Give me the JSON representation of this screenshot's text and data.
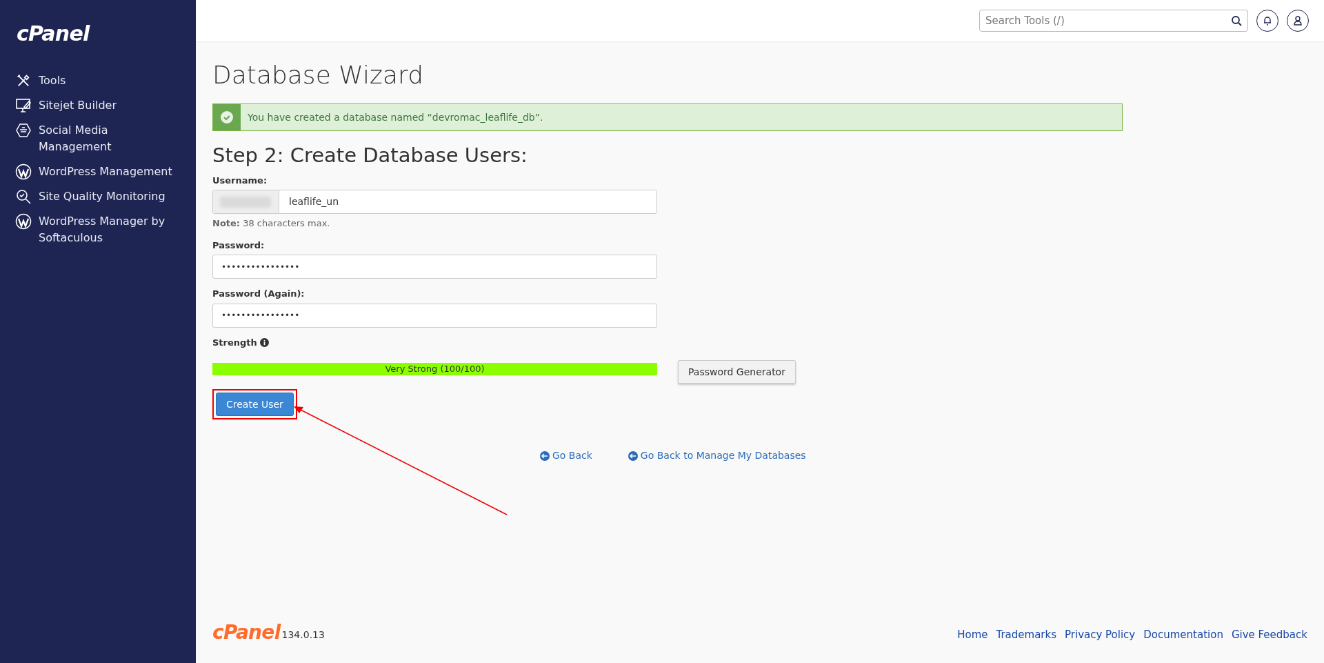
{
  "sidebar": {
    "logo": "cPanel",
    "items": [
      {
        "label": "Tools",
        "kind": "tools"
      },
      {
        "label": "Sitejet Builder",
        "kind": "builder"
      },
      {
        "label": "Social Media Management",
        "kind": "social"
      },
      {
        "label": "WordPress Management",
        "kind": "wordpress"
      },
      {
        "label": "Site Quality Monitoring",
        "kind": "monitoring"
      },
      {
        "label": "WordPress Manager by Softaculous",
        "kind": "wordpress"
      }
    ]
  },
  "header": {
    "search": {
      "placeholder": "Search Tools (/)"
    }
  },
  "page": {
    "title": "Database Wizard",
    "alert": {
      "kind": "success",
      "text": "You have created a database named “devromac_leaflife_db”."
    },
    "heading": "Step 2: Create Database Users:",
    "username": {
      "label": "Username:",
      "value": "leaflife_un",
      "note_label": "Note:",
      "note": "38 characters max."
    },
    "password": {
      "label": "Password:",
      "value": "••••••••••••••••"
    },
    "password_again": {
      "label": "Password (Again):",
      "value": "••••••••••••••••"
    },
    "strength": {
      "label": "Strength",
      "level": 1,
      "reading": "Very Strong (100/100)"
    },
    "generator_button": "Password Generator",
    "create_button": "Create User",
    "links": [
      "Go Back",
      "Go Back to Manage My Databases"
    ]
  },
  "footer": {
    "logo": "cPanel",
    "version": "134.0.13",
    "links": [
      "Home",
      "Trademarks",
      "Privacy Policy",
      "Documentation",
      "Give Feedback"
    ]
  }
}
